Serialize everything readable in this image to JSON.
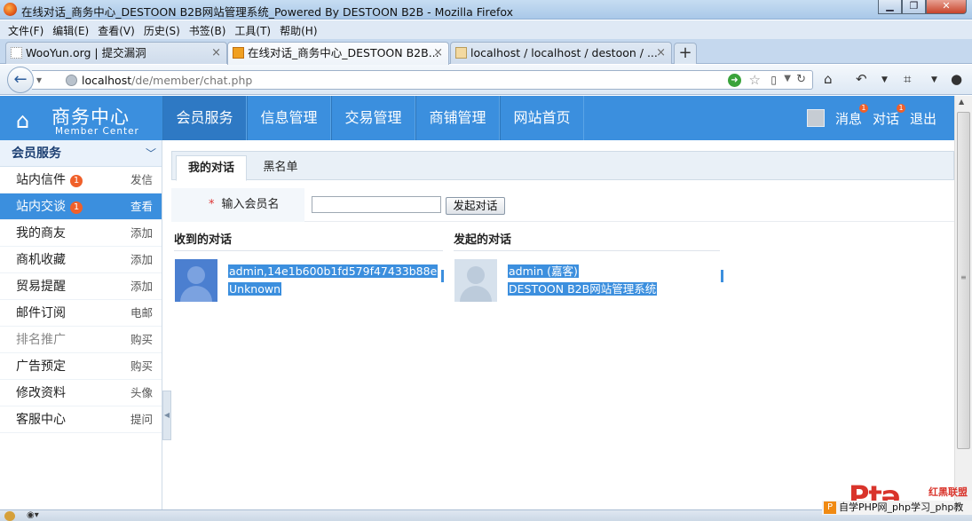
{
  "window": {
    "title": "在线对话_商务中心_DESTOON B2B网站管理系统_Powered By DESTOON B2B - Mozilla Firefox"
  },
  "menu": [
    "文件(F)",
    "编辑(E)",
    "查看(V)",
    "历史(S)",
    "书签(B)",
    "工具(T)",
    "帮助(H)"
  ],
  "tabs": [
    {
      "label": "WooYun.org | 提交漏洞"
    },
    {
      "label": "在线对话_商务中心_DESTOON B2B..."
    },
    {
      "label": "localhost / localhost / destoon / ..."
    }
  ],
  "address": {
    "host": "localhost",
    "path": "/de/member/chat.php"
  },
  "header": {
    "logo_title": "商务中心",
    "logo_subtitle": "Member Center",
    "nav": [
      "会员服务",
      "信息管理",
      "交易管理",
      "商铺管理",
      "网站首页"
    ],
    "links": {
      "messages": "消息",
      "messages_badge": "1",
      "chat": "对话",
      "chat_badge": "1",
      "logout": "退出"
    }
  },
  "sidebar": {
    "title": "会员服务",
    "items": [
      {
        "label": "站内信件",
        "badge": "1",
        "action": "发信"
      },
      {
        "label": "站内交谈",
        "badge": "1",
        "action": "查看"
      },
      {
        "label": "我的商友",
        "action": "添加"
      },
      {
        "label": "商机收藏",
        "action": "添加"
      },
      {
        "label": "贸易提醒",
        "action": "添加"
      },
      {
        "label": "邮件订阅",
        "action": "电邮"
      },
      {
        "label": "排名推广",
        "action": "购买"
      },
      {
        "label": "广告预定",
        "action": "购买"
      },
      {
        "label": "修改资料",
        "action": "头像"
      },
      {
        "label": "客服中心",
        "action": "提问"
      }
    ]
  },
  "content": {
    "tabs": [
      "我的对话",
      "黑名单"
    ],
    "form": {
      "label": "输入会员名",
      "required_mark": "*",
      "input_value": "",
      "button": "发起对话"
    },
    "received": {
      "title": "收到的对话",
      "item": {
        "line1": "admin,14e1b600b1fd579f47433b88e",
        "line2": "Unknown"
      }
    },
    "initiated": {
      "title": "发起的对话",
      "item": {
        "line1": "admin (嘉客)",
        "line2": "DESTOON B2B网站管理系统"
      }
    }
  },
  "watermark": {
    "logo_text": "Ptə",
    "tag": "红黑联盟",
    "bar_text": "自学PHP网_php学习_php教"
  }
}
